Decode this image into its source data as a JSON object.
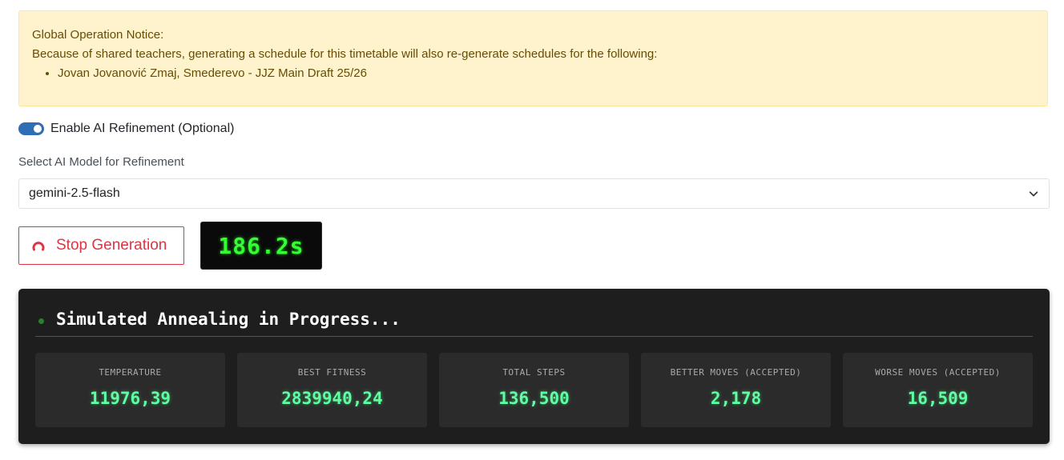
{
  "notice": {
    "title": "Global Operation Notice:",
    "text": "Because of shared teachers, generating a schedule for this timetable will also re-generate schedules for the following:",
    "items": [
      "Jovan Jovanović Zmaj, Smederevo - JJZ Main Draft 25/26"
    ]
  },
  "ai_refinement": {
    "toggle_label": "Enable AI Refinement (Optional)",
    "enabled": true,
    "select_label": "Select AI Model for Refinement",
    "selected_model": "gemini-2.5-flash"
  },
  "controls": {
    "stop_label": "Stop Generation",
    "timer": "186.2s"
  },
  "progress": {
    "title": "Simulated Annealing in Progress...",
    "stats": [
      {
        "label": "TEMPERATURE",
        "value": "11976,39"
      },
      {
        "label": "BEST FITNESS",
        "value": "2839940,24"
      },
      {
        "label": "TOTAL STEPS",
        "value": "136,500"
      },
      {
        "label": "BETTER MOVES (ACCEPTED)",
        "value": "2,178"
      },
      {
        "label": "WORSE MOVES (ACCEPTED)",
        "value": "16,509"
      }
    ]
  },
  "colors": {
    "notice_bg": "#fff3cd",
    "notice_text": "#664d03",
    "danger": "#dc3545",
    "toggle_on": "#2f6db5",
    "timer_green": "#33ff33",
    "stat_value": "#5dffa0",
    "panel_bg": "#1e1e1e"
  }
}
